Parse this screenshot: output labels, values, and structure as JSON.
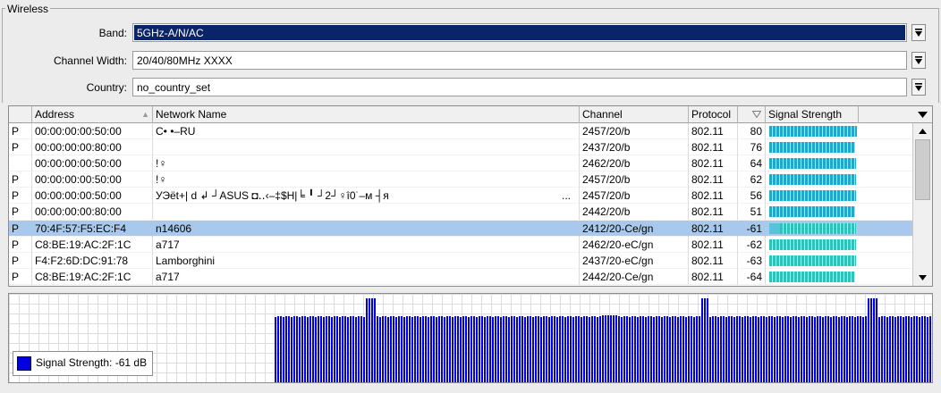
{
  "wireless": {
    "group_title": "Wireless",
    "band": {
      "label": "Band:",
      "value": "5GHz-A/N/AC"
    },
    "channel_width": {
      "label": "Channel Width:",
      "value": "20/40/80MHz XXXX"
    },
    "country": {
      "label": "Country:",
      "value": "no_country_set"
    }
  },
  "table": {
    "columns": [
      "Address",
      "Network Name",
      "Channel",
      "Protocol",
      "",
      "Signal Strength"
    ],
    "rows": [
      {
        "flag": "P",
        "address": "00:00:00:00:50:00",
        "name": "C•     •–RU",
        "channel": "2457/20/b",
        "protocol": "802.11",
        "signal": "80",
        "strength": 0.98
      },
      {
        "flag": "P",
        "address": "00:00:00:00:80:00",
        "name": "",
        "channel": "2437/20/b",
        "protocol": "802.11",
        "signal": "76",
        "strength": 0.96
      },
      {
        "flag": "",
        "address": "00:00:00:00:50:00",
        "name": "!♀",
        "channel": "2462/20/b",
        "protocol": "802.11",
        "signal": "64",
        "strength": 0.97
      },
      {
        "flag": "P",
        "address": "00:00:00:00:50:00",
        "name": "!♀",
        "channel": "2457/20/b",
        "protocol": "802.11",
        "signal": "62",
        "strength": 0.97
      },
      {
        "flag": "P",
        "address": "00:00:00:00:50:00",
        "name": "УЭёt+|   d  ↲  ┘ASUS   ◘‥‹–‡$H|╘  ╹  ┘2┘♀î0˙–м   ┤я",
        "name_suffix": "...",
        "channel": "2457/20/b",
        "protocol": "802.11",
        "signal": "56",
        "strength": 0.97
      },
      {
        "flag": "P",
        "address": "00:00:00:00:80:00",
        "name": "",
        "channel": "2442/20/b",
        "protocol": "802.11",
        "signal": "51",
        "strength": 0.96
      },
      {
        "flag": "P",
        "address": "70:4F:57:F5:EC:F4",
        "name": "n14606",
        "channel": "2412/20-Ce/gn",
        "protocol": "802.11",
        "signal": "-61",
        "strength": 0.97
      },
      {
        "flag": "P",
        "address": "C8:BE:19:AC:2F:1C",
        "name": "a717",
        "channel": "2462/20-eC/gn",
        "protocol": "802.11",
        "signal": "-62",
        "strength": 0.97
      },
      {
        "flag": "P",
        "address": "F4:F2:6D:DC:91:78",
        "name": "Lamborghini",
        "channel": "2437/20-eC/gn",
        "protocol": "802.11",
        "signal": "-63",
        "strength": 0.97
      },
      {
        "flag": "P",
        "address": "C8:BE:19:AC:2F:1C",
        "name": "a717",
        "channel": "2442/20-Ce/gn",
        "protocol": "802.11",
        "signal": "-64",
        "strength": 0.96
      }
    ],
    "selected_row": 6
  },
  "graph": {
    "legend_label": "Signal Strength:",
    "legend_value": "-61 dB",
    "series_color": "#0000e0"
  },
  "colors": {
    "selection": "#a8c8ec",
    "field_highlight": "#0a246a",
    "signal_bar": "#22a6c9"
  }
}
